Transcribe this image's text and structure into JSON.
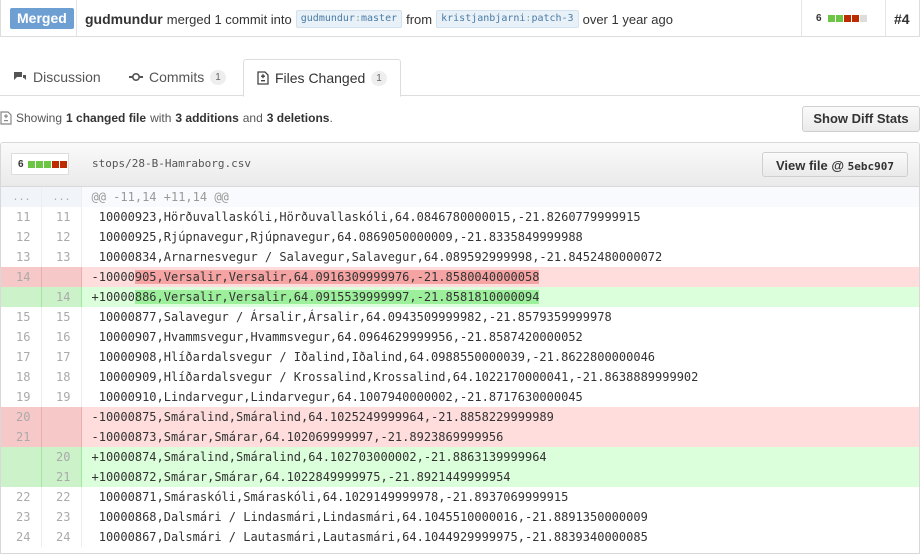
{
  "header": {
    "status": "Merged",
    "user": "gudmundur",
    "action": "merged 1 commit into",
    "base_user": "gudmundur",
    "base_branch": "master",
    "from_word": "from",
    "head_user": "kristjanbjarni",
    "head_branch": "patch-3",
    "time": "over 1 year ago",
    "diff_count": "6",
    "pr_number": "#4",
    "colors": {
      "badge": "#6e9fd3",
      "add": "#6cc644",
      "del": "#bd2c00",
      "neutral": "#ddd"
    }
  },
  "tabs": [
    {
      "label": "Discussion",
      "icon": "discussion-icon"
    },
    {
      "label": "Commits",
      "icon": "commit-icon",
      "count": "1"
    },
    {
      "label": "Files Changed",
      "icon": "file-diff-icon",
      "count": "1"
    }
  ],
  "summary": {
    "prefix": "Showing",
    "files": "1 changed file",
    "with": "with",
    "additions": "3 additions",
    "and": "and",
    "deletions": "3 deletions",
    "period": "."
  },
  "diff_stats_button": "Show Diff Stats",
  "file": {
    "diff_count": "6",
    "path": "stops/28-B-Hamraborg.csv",
    "view_label": "View file @",
    "sha": "5ebc907"
  },
  "diff_rows": [
    {
      "type": "hunk",
      "old": "...",
      "new": "...",
      "text": "@@ -11,14 +11,14 @@"
    },
    {
      "type": "ctx",
      "old": "11",
      "new": "11",
      "text": " 10000923,Hörðuvallaskóli,Hörðuvallaskóli,64.0846780000015,-21.8260779999915"
    },
    {
      "type": "ctx",
      "old": "12",
      "new": "12",
      "text": " 10000925,Rjúpnavegur,Rjúpnavegur,64.0869050000009,-21.8335849999988"
    },
    {
      "type": "ctx",
      "old": "13",
      "new": "13",
      "text": " 10000834,Arnarnesvegur / Salavegur,Salavegur,64.089592999998,-21.8452480000072"
    },
    {
      "type": "del",
      "old": "14",
      "new": "",
      "pre": "-10000",
      "hl": "905,Versalir,Versalir,64.0916309999976,-21.8580040000058",
      "post": ""
    },
    {
      "type": "add",
      "old": "",
      "new": "14",
      "pre": "+10000",
      "hl": "886,Versalir,Versalir,64.0915539999997,-21.8581810000094",
      "post": ""
    },
    {
      "type": "ctx",
      "old": "15",
      "new": "15",
      "text": " 10000877,Salavegur / Ársalir,Ársalir,64.0943509999982,-21.8579359999978"
    },
    {
      "type": "ctx",
      "old": "16",
      "new": "16",
      "text": " 10000907,Hvammsvegur,Hvammsvegur,64.0964629999956,-21.8587420000052"
    },
    {
      "type": "ctx",
      "old": "17",
      "new": "17",
      "text": " 10000908,Hlíðardalsvegur / Iðalind,Iðalind,64.0988550000039,-21.8622800000046"
    },
    {
      "type": "ctx",
      "old": "18",
      "new": "18",
      "text": " 10000909,Hlíðardalsvegur / Krossalind,Krossalind,64.1022170000041,-21.8638889999902"
    },
    {
      "type": "ctx",
      "old": "19",
      "new": "19",
      "text": " 10000910,Lindarvegur,Lindarvegur,64.1007940000002,-21.8717630000045"
    },
    {
      "type": "del",
      "old": "20",
      "new": "",
      "pre": "-10000875,Smáralind,Smáralind,64.1025249999964,-21.8858229999989",
      "hl": "",
      "post": ""
    },
    {
      "type": "del",
      "old": "21",
      "new": "",
      "pre": "-10000873,Smárar,Smárar,64.102069999997,-21.8923869999956",
      "hl": "",
      "post": ""
    },
    {
      "type": "add",
      "old": "",
      "new": "20",
      "pre": "+10000874,Smáralind,Smáralind,64.102703000002,-21.8863139999964",
      "hl": "",
      "post": ""
    },
    {
      "type": "add",
      "old": "",
      "new": "21",
      "pre": "+10000872,Smárar,Smárar,64.1022849999975,-21.8921449999954",
      "hl": "",
      "post": ""
    },
    {
      "type": "ctx",
      "old": "22",
      "new": "22",
      "text": " 10000871,Smáraskóli,Smáraskóli,64.1029149999978,-21.8937069999915"
    },
    {
      "type": "ctx",
      "old": "23",
      "new": "23",
      "text": " 10000868,Dalsmári / Lindasmári,Lindasmári,64.1045510000016,-21.8891350000009"
    },
    {
      "type": "ctx",
      "old": "24",
      "new": "24",
      "text": " 10000867,Dalsmári / Lautasmári,Lautasmári,64.1044929999975,-21.8839340000085"
    }
  ]
}
